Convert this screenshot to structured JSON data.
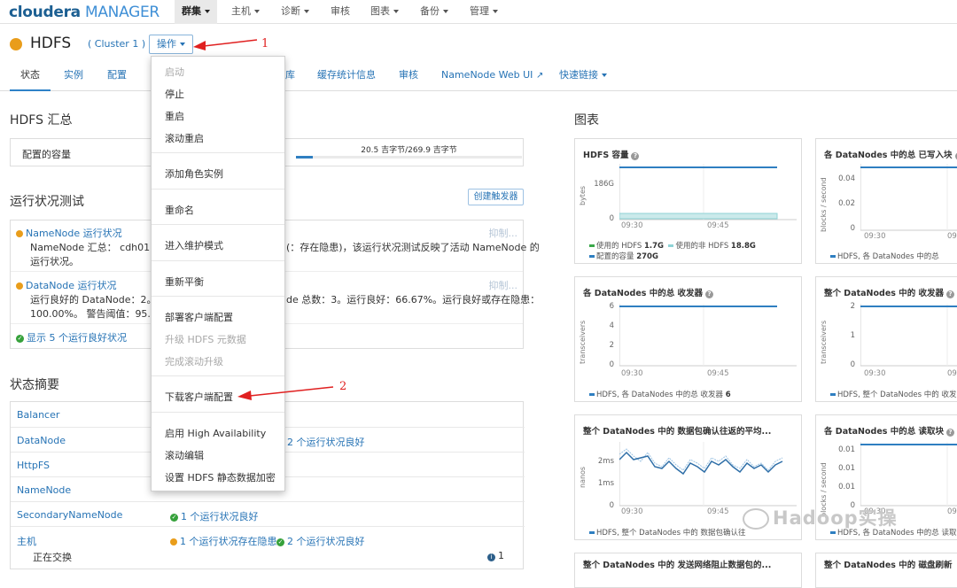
{
  "topnav": {
    "logo_a": "cloudera",
    "logo_b": "MANAGER",
    "items": [
      "群集",
      "主机",
      "诊断",
      "审核",
      "图表",
      "备份",
      "管理"
    ]
  },
  "header": {
    "service": "HDFS",
    "cluster": "( Cluster 1 )",
    "ops_button": "操作"
  },
  "annotations": [
    "1",
    "2"
  ],
  "tabs": [
    "状态",
    "实例",
    "配置",
    "库",
    "缓存统计信息",
    "审核",
    "NameNode Web UI",
    "快速链接"
  ],
  "summary": {
    "title": "HDFS 汇总",
    "capacity_label": "配置的容量",
    "capacity_value": "20.5 吉字节/269.9 吉字节",
    "capacity_fraction": 0.076
  },
  "health": {
    "title": "运行状况测试",
    "create_trigger": "创建触发器",
    "tests": [
      {
        "name": "NameNode 运行状况",
        "suppress": "抑制...",
        "line1a": "NameNode 汇总： cdh01.mac",
        "line1b": "(：存在隐患)，该运行状况测试反映了活动 NameNode 的",
        "line2": "运行状况。"
      },
      {
        "name": "DataNode 运行状况",
        "suppress": "抑制...",
        "line1a": "运行良好的 DataNode：2。存",
        "line1b": "de 总数：3。运行良好：66.67%。运行良好或存在隐患：",
        "line2": "100.00%。 警告阈值：95.00%"
      }
    ],
    "show_good": "显示 5 个运行良好状况"
  },
  "status": {
    "title": "状态摘要",
    "rows": [
      {
        "k": "Balancer",
        "v": ""
      },
      {
        "k": "DataNode",
        "v": "2 个运行状况良好"
      },
      {
        "k": "HttpFS",
        "v": ""
      },
      {
        "k": "NameNode",
        "v": ""
      },
      {
        "k": "SecondaryNameNode",
        "v": "1 个运行状况良好"
      },
      {
        "k": "主机",
        "v1": "1 个运行状况存在隐患",
        "v2": "2 个运行状况良好"
      }
    ],
    "sub": "正在交换",
    "sub_count": "1"
  },
  "menu": {
    "items": [
      "启动",
      "停止",
      "重启",
      "滚动重启",
      "添加角色实例",
      "重命名",
      "进入维护模式",
      "重新平衡",
      "部署客户端配置",
      "升级 HDFS 元数据",
      "完成滚动升级",
      "下载客户端配置",
      "启用 High Availability",
      "滚动编辑",
      "设置 HDFS 静态数据加密"
    ]
  },
  "charts_title": "图表",
  "charts": [
    {
      "title": "HDFS 容量",
      "ylabel": "bytes",
      "yticks": [
        "186G",
        "0"
      ],
      "xticks": [
        "09:30",
        "09:45"
      ],
      "legend": [
        {
          "label": "使用的 HDFS",
          "value": "1.7G",
          "color": "#3aa84a"
        },
        {
          "label": "使用的非 HDFS",
          "value": "18.8G",
          "color": "#8fd3d6"
        },
        {
          "label": "配置的容量",
          "value": "270G",
          "color": "#2f7fc1"
        }
      ]
    },
    {
      "title": "各 DataNodes 中的总 已写入块",
      "ylabel": "blocks / second",
      "yticks": [
        "0.04",
        "0.02",
        "0"
      ],
      "xticks": [
        "09:30",
        "09"
      ],
      "legend": [
        {
          "label": "HDFS, 各 DataNodes 中的总",
          "value": "",
          "color": "#2f7fc1"
        }
      ]
    },
    {
      "title": "各 DataNodes 中的总 收发器",
      "ylabel": "transceivers",
      "yticks": [
        "6",
        "4",
        "2",
        "0"
      ],
      "xticks": [
        "09:30",
        "09:45"
      ],
      "legend": [
        {
          "label": "HDFS, 各 DataNodes 中的总 收发器",
          "value": "6",
          "color": "#2f7fc1"
        }
      ]
    },
    {
      "title": "整个 DataNodes 中的 收发器",
      "ylabel": "transceivers",
      "yticks": [
        "2",
        "1",
        "0"
      ],
      "xticks": [
        "09:30",
        "09"
      ],
      "legend": [
        {
          "label": "HDFS, 整个 DataNodes 中的 收发",
          "value": "",
          "color": "#2f7fc1"
        }
      ]
    },
    {
      "title": "整个 DataNodes 中的 数据包确认往返的平均...",
      "ylabel": "nanos",
      "yticks": [
        "2ms",
        "1ms",
        "0"
      ],
      "xticks": [
        "09:30",
        "09:45"
      ],
      "legend": [
        {
          "label": "HDFS, 整个 DataNodes 中的 数据包确认往",
          "value": "",
          "color": "#2f7fc1"
        }
      ]
    },
    {
      "title": "各 DataNodes 中的总 读取块",
      "ylabel": "blocks / second",
      "yticks": [
        "0.01",
        "0.01",
        "0.01",
        "0"
      ],
      "xticks": [
        "09:30",
        "09"
      ],
      "legend": [
        {
          "label": "HDFS, 各 DataNodes 中的总 读取",
          "value": "",
          "color": "#2f7fc1"
        }
      ]
    },
    {
      "title": "整个 DataNodes 中的 发送网络阻止数据包的..."
    },
    {
      "title": "整个 DataNodes 中的 磁盘刷新"
    }
  ],
  "watermark": "Hadoop实操"
}
